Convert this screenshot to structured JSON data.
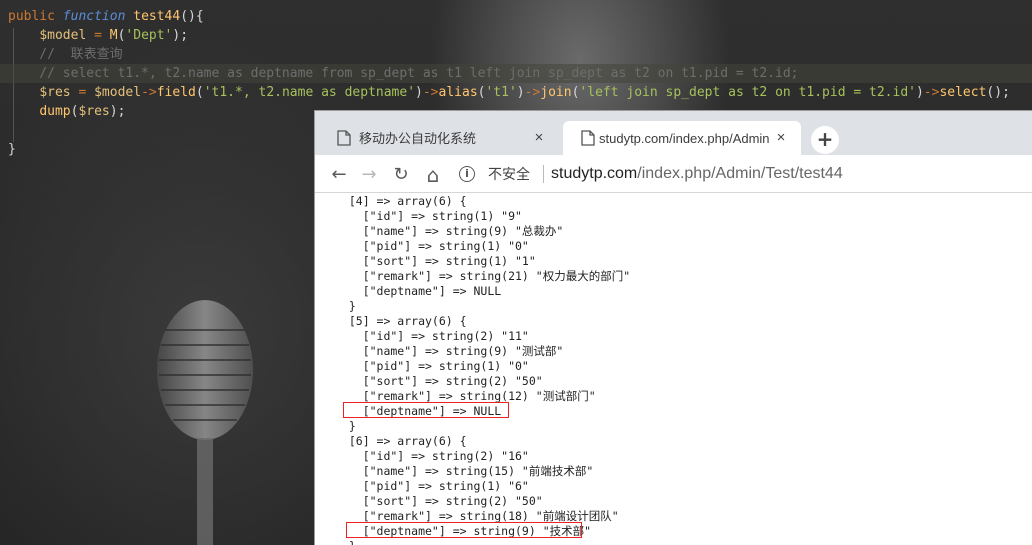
{
  "editor": {
    "lines": [
      [
        {
          "t": "public ",
          "c": "kw"
        },
        {
          "t": "function ",
          "c": "kw-i"
        },
        {
          "t": "test44",
          "c": "fn"
        },
        {
          "t": "(){",
          "c": "pn"
        }
      ],
      [
        {
          "t": "    ",
          "c": "pn"
        },
        {
          "t": "$model",
          "c": "var"
        },
        {
          "t": " = ",
          "c": "op"
        },
        {
          "t": "M",
          "c": "mtd"
        },
        {
          "t": "(",
          "c": "pn"
        },
        {
          "t": "'Dept'",
          "c": "str"
        },
        {
          "t": ");",
          "c": "pn"
        }
      ],
      [
        {
          "t": "    //  联表查询",
          "c": "cm"
        }
      ],
      [
        {
          "t": "    // select t1.*, t2.name as deptname from sp_dept as t1 left join sp_dept as t2 on t1.pid = t2.id;",
          "c": "cm"
        }
      ],
      [
        {
          "t": "    ",
          "c": "pn"
        },
        {
          "t": "$res",
          "c": "var"
        },
        {
          "t": " = ",
          "c": "op"
        },
        {
          "t": "$model",
          "c": "var"
        },
        {
          "t": "->",
          "c": "op"
        },
        {
          "t": "field",
          "c": "mtd"
        },
        {
          "t": "(",
          "c": "pn"
        },
        {
          "t": "'t1.*, t2.name as deptname'",
          "c": "str"
        },
        {
          "t": ")",
          "c": "pn"
        },
        {
          "t": "->",
          "c": "op"
        },
        {
          "t": "alias",
          "c": "mtd"
        },
        {
          "t": "(",
          "c": "pn"
        },
        {
          "t": "'t1'",
          "c": "str"
        },
        {
          "t": ")",
          "c": "pn"
        },
        {
          "t": "->",
          "c": "op"
        },
        {
          "t": "join",
          "c": "mtd"
        },
        {
          "t": "(",
          "c": "pn"
        },
        {
          "t": "'left join sp_dept as t2 on t1.pid = t2.id'",
          "c": "str"
        },
        {
          "t": ")",
          "c": "pn"
        },
        {
          "t": "->",
          "c": "op"
        },
        {
          "t": "select",
          "c": "mtd"
        },
        {
          "t": "();",
          "c": "pn"
        }
      ],
      [
        {
          "t": "    ",
          "c": "pn"
        },
        {
          "t": "dump",
          "c": "mtd"
        },
        {
          "t": "(",
          "c": "pn"
        },
        {
          "t": "$res",
          "c": "var"
        },
        {
          "t": ");",
          "c": "pn"
        }
      ],
      [
        {
          "t": "",
          "c": "pn"
        }
      ],
      [
        {
          "t": "}",
          "c": "pn"
        }
      ]
    ]
  },
  "browser": {
    "tabs": [
      {
        "title": "移动办公自动化系统",
        "close": "×",
        "active": false
      },
      {
        "title": "studytp.com/index.php/Admin",
        "close": "×",
        "active": true
      }
    ],
    "new_tab": "+",
    "nav": {
      "back": "←",
      "forward": "→",
      "reload": "↻",
      "home": "⌂"
    },
    "omnibox": {
      "info": "i",
      "security_label": "不安全",
      "url_host": "studytp.com",
      "url_path": "/index.php/Admin/Test/test44"
    }
  },
  "dump": {
    "lines": [
      "  [4] => array(6) {",
      "    [\"id\"] => string(1) \"9\"",
      "    [\"name\"] => string(9) \"总裁办\"",
      "    [\"pid\"] => string(1) \"0\"",
      "    [\"sort\"] => string(1) \"1\"",
      "    [\"remark\"] => string(21) \"权力最大的部门\"",
      "    [\"deptname\"] => NULL",
      "  }",
      "  [5] => array(6) {",
      "    [\"id\"] => string(2) \"11\"",
      "    [\"name\"] => string(9) \"测试部\"",
      "    [\"pid\"] => string(1) \"0\"",
      "    [\"sort\"] => string(2) \"50\"",
      "    [\"remark\"] => string(12) \"测试部门\"",
      "    [\"deptname\"] => NULL",
      "  }",
      "  [6] => array(6) {",
      "    [\"id\"] => string(2) \"16\"",
      "    [\"name\"] => string(15) \"前端技术部\"",
      "    [\"pid\"] => string(1) \"6\"",
      "    [\"sort\"] => string(2) \"50\"",
      "    [\"remark\"] => string(18) \"前端设计团队\"",
      "    [\"deptname\"] => string(9) \"技术部\"",
      "  }"
    ],
    "highlighted_rows": [
      14,
      22
    ]
  }
}
